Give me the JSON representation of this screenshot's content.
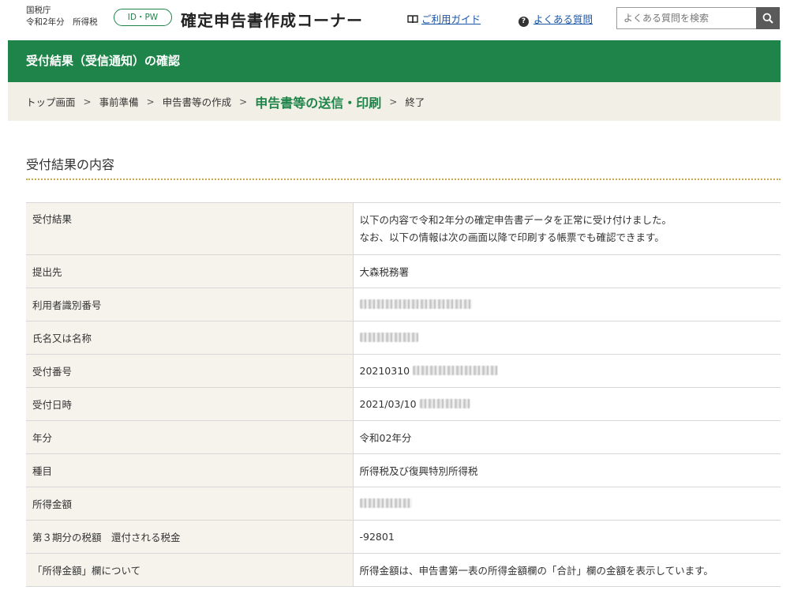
{
  "header": {
    "agency": "国税庁",
    "year_tax": "令和2年分　所得税",
    "auth_badge": "ID・PW",
    "app_title": "確定申告書作成コーナー",
    "guide_link": "ご利用ガイド",
    "faq_link": "よくある質問",
    "search": {
      "placeholder": "よくある質問を検索",
      "value": ""
    }
  },
  "page_title": "受付結果（受信通知）の確認",
  "breadcrumb": [
    "トップ画面",
    "事前準備",
    "申告書等の作成",
    "申告書等の送信・印刷",
    "終了"
  ],
  "section_title": "受付結果の内容",
  "rows": [
    {
      "label": "受付結果",
      "lines": [
        "以下の内容で令和2年分の確定申告書データを正常に受け付けました。",
        "なお、以下の情報は次の画面以降で印刷する帳票でも確認できます。"
      ]
    },
    {
      "label": "提出先",
      "value": "大森税務署"
    },
    {
      "label": "利用者識別番号",
      "value": ""
    },
    {
      "label": "氏名又は名称",
      "value": ""
    },
    {
      "label": "受付番号",
      "value": "20210310"
    },
    {
      "label": "受付日時",
      "value": "2021/03/10"
    },
    {
      "label": "年分",
      "value": "令和02年分"
    },
    {
      "label": "種目",
      "value": "所得税及び復興特別所得税"
    },
    {
      "label": "所得金額",
      "value": ""
    },
    {
      "label": "第３期分の税額　還付される税金",
      "value": "-92801"
    },
    {
      "label": "「所得金額」欄について",
      "value": "所得金額は、申告書第一表の所得金額欄の「合計」欄の金額を表示しています。"
    }
  ],
  "colors": {
    "brand_green": "#1e8449",
    "breadcrumb_bg": "#f2efe6",
    "label_bg": "#f5f3ec",
    "link": "#1a56a8",
    "dotted_rule": "#c8a84b"
  },
  "icons": {
    "guide": "book-icon",
    "faq": "help-icon",
    "search": "search-icon",
    "separator": "chevron-right-icon"
  }
}
